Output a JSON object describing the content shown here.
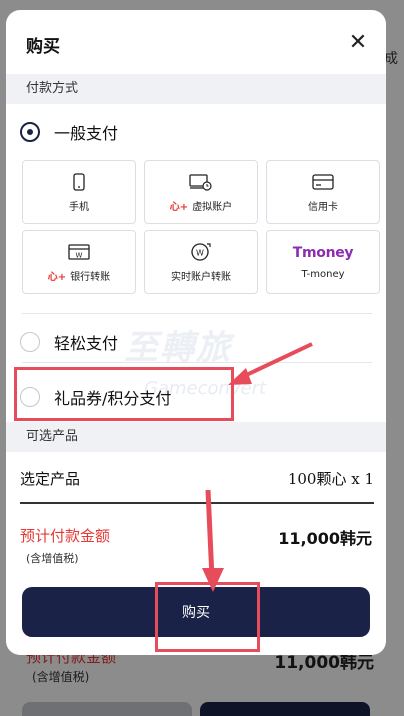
{
  "background": {
    "right_edge_text": "成",
    "price_label": "预计付款金额",
    "tax_note": "(含增值税)",
    "price": "11,000韩元"
  },
  "modal": {
    "title": "购买",
    "close_symbol": "✕",
    "payment_section_title": "付款方式",
    "general_payment_label": "一般支付",
    "methods": [
      {
        "label": "手机",
        "icon": "phone-icon",
        "badge": ""
      },
      {
        "label": "虚拟账户",
        "icon": "virtual-account-icon",
        "badge": "心+"
      },
      {
        "label": "信用卡",
        "icon": "credit-card-icon",
        "badge": ""
      },
      {
        "label": "银行转账",
        "icon": "bank-transfer-icon",
        "badge": "心+"
      },
      {
        "label": "实时账户转账",
        "icon": "realtime-transfer-icon",
        "badge": ""
      },
      {
        "label": "T-money",
        "icon": "tmoney-logo",
        "badge": "",
        "logo_text": "Tmoney"
      }
    ],
    "easy_payment_label": "轻松支付",
    "gift_points_label": "礼品券/积分支付",
    "optional_section_title": "可选产品",
    "selected_product_label": "选定产品",
    "selected_product_value": "100颗心 x 1",
    "estimated_price_label": "预计付款金额",
    "tax_note": "(含增值税)",
    "estimated_price_value": "11,000韩元",
    "buy_button_label": "购买"
  },
  "colors": {
    "navy": "#1a2347",
    "accent_red": "#e53935",
    "annotation_red": "#e74c5b"
  }
}
